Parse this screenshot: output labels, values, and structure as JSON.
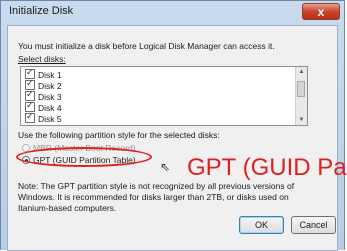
{
  "window": {
    "title": "Initialize Disk",
    "close_glyph": "x"
  },
  "intro_text": "You must initialize a disk before Logical Disk Manager can access it.",
  "select_label": "Select disks:",
  "disks": [
    {
      "label": "Disk 1",
      "checked": true
    },
    {
      "label": "Disk 2",
      "checked": true
    },
    {
      "label": "Disk 3",
      "checked": true
    },
    {
      "label": "Disk 4",
      "checked": true
    },
    {
      "label": "Disk 5",
      "checked": true
    }
  ],
  "partition_label": "Use the following partition style for the selected disks:",
  "options": [
    {
      "label": "MBR (Master Boot Record)",
      "selected": false
    },
    {
      "label": "GPT (GUID Partition Table)",
      "selected": true
    }
  ],
  "annotation": "GPT (GUID Pa",
  "note_lines": [
    "Note: The GPT partition style is not recognized by all previous versions of",
    "Windows. It is recommended for disks larger than 2TB, or disks used on",
    "Itanium-based computers."
  ],
  "buttons": {
    "ok": "OK",
    "cancel": "Cancel"
  },
  "colors": {
    "annotation": "#e02020",
    "close_button": "#c8452c"
  },
  "icons": [
    "close-icon",
    "checkbox-checked-icon",
    "scroll-up-icon",
    "scroll-down-icon",
    "mouse-pointer-icon"
  ]
}
